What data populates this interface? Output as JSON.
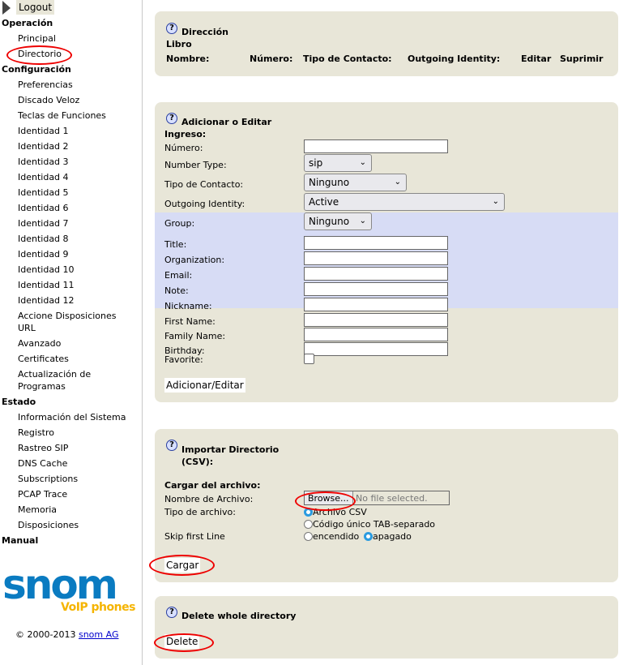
{
  "sidebar": {
    "logout": "Logout",
    "operacion": "Operación",
    "principal": "Principal",
    "directorio": "Directorio",
    "configuracion": "Configuración",
    "config_items": [
      "Preferencias",
      "Discado Veloz",
      "Teclas de Funciones",
      "Identidad 1",
      "Identidad 2",
      "Identidad 3",
      "Identidad 4",
      "Identidad 5",
      "Identidad 6",
      "Identidad 7",
      "Identidad 8",
      "Identidad 9",
      "Identidad 10",
      "Identidad 11",
      "Identidad 12"
    ],
    "accione": "Accione Disposiciones URL",
    "avanzado": "Avanzado",
    "certificates": "Certificates",
    "actualizacion": "Actualización de Programas",
    "estado": "Estado",
    "estado_items": [
      "Información del Sistema",
      "Registro",
      "Rastreo SIP",
      "DNS Cache",
      "Subscriptions",
      "PCAP Trace",
      "Memoria",
      "Disposiciones"
    ],
    "manual": "Manual",
    "logo_text": "snom",
    "logo_sub": "VoIP phones",
    "copyright": "© 2000-2013",
    "company_link": "snom AG"
  },
  "directory": {
    "title1": "Dirección",
    "title2": "Libro",
    "columns": [
      "Nombre:",
      "Número:",
      "Tipo de Contacto:",
      "Outgoing Identity:",
      "Editar",
      "Suprimir"
    ]
  },
  "edit": {
    "title": "Adicionar o Editar",
    "subtitle": "Ingreso:",
    "numero": "Número:",
    "number_type": "Number Type:",
    "number_type_value": "sip",
    "tipo": "Tipo de Contacto:",
    "tipo_value": "Ninguno",
    "outgoing": "Outgoing Identity:",
    "outgoing_value": "Active",
    "group": "Group:",
    "group_value": "Ninguno",
    "fields": [
      "Title:",
      "Organization:",
      "Email:",
      "Note:",
      "Nickname:",
      "First Name:",
      "Family Name:",
      "Birthday:"
    ],
    "favorite": "Favorite:",
    "submit": "Adicionar/Editar"
  },
  "import": {
    "title": "Importar Directorio (CSV):",
    "subtitle": "Cargar del archivo:",
    "file_label": "Nombre de Archivo:",
    "browse": "Browse...",
    "no_file": "No file selected.",
    "type_label": "Tipo de archivo:",
    "type_csv": "Archivo CSV",
    "type_tab": "Código único TAB-separado",
    "skip_label": "Skip first Line",
    "skip_on": "encendido",
    "skip_off": "apagado",
    "submit": "Cargar"
  },
  "delete": {
    "title": "Delete whole directory",
    "submit": "Delete"
  }
}
